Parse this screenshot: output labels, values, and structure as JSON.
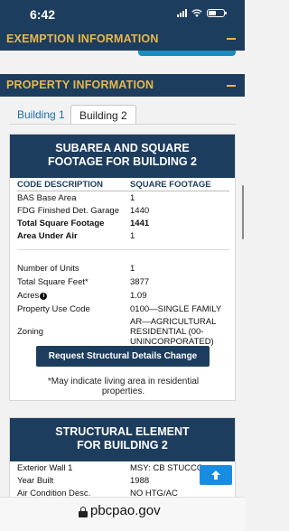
{
  "status_bar": {
    "time": "6:42"
  },
  "sections": {
    "exemption": "EXEMPTION INFORMATION",
    "property": "PROPERTY INFORMATION"
  },
  "tabs": [
    {
      "label": "Building 1",
      "active": false
    },
    {
      "label": "Building 2",
      "active": true
    }
  ],
  "subarea": {
    "title_line1": "SUBAREA AND SQUARE",
    "title_line2": "FOOTAGE FOR BUILDING 2",
    "columns": [
      "CODE DESCRIPTION",
      "SQUARE FOOTAGE"
    ],
    "rows": [
      {
        "label": "BAS Base Area",
        "value": "1"
      },
      {
        "label": "FDG Finished Det. Garage",
        "value": "1440"
      },
      {
        "label": "Total Square Footage",
        "value": "1441"
      },
      {
        "label": "Area Under Air",
        "value": "1"
      }
    ]
  },
  "details": {
    "units_label": "Number of Units",
    "units_value": "1",
    "total_sqft_label": "Total Square Feet*",
    "total_sqft_value": "3877",
    "acres_label": "Acres",
    "acres_value": "1.09",
    "use_code_label": "Property Use Code",
    "use_code_value": "0100—SINGLE FAMILY",
    "zoning_label": "Zoning",
    "zoning_line1": "AR—AGRICULTURAL",
    "zoning_line2": "RESIDENTIAL (00-",
    "zoning_line3": "UNINCORPORATED)"
  },
  "request_button": "Request Structural Details Change",
  "note_line1": "*May indicate living area in residential",
  "note_line2": "properties.",
  "structural": {
    "title_line1": "STRUCTURAL ELEMENT",
    "title_line2": "FOR BUILDING 2",
    "rows": [
      {
        "label": "Exterior Wall 1",
        "value": "MSY: CB STUCCO"
      },
      {
        "label": "Year Built",
        "value": "1988"
      },
      {
        "label": "Air Condition Desc.",
        "value": "NO HTG/AC"
      }
    ]
  },
  "url": "pbcpao.gov",
  "colors": {
    "navy": "#1d3d5e",
    "gold": "#e8b84a",
    "accent_blue": "#1a8ce0",
    "link": "#1e6fa8"
  },
  "icons": [
    "signal-icon",
    "wifi-icon",
    "battery-icon",
    "minus-icon",
    "info-icon",
    "arrow-up-icon",
    "lock-icon"
  ]
}
